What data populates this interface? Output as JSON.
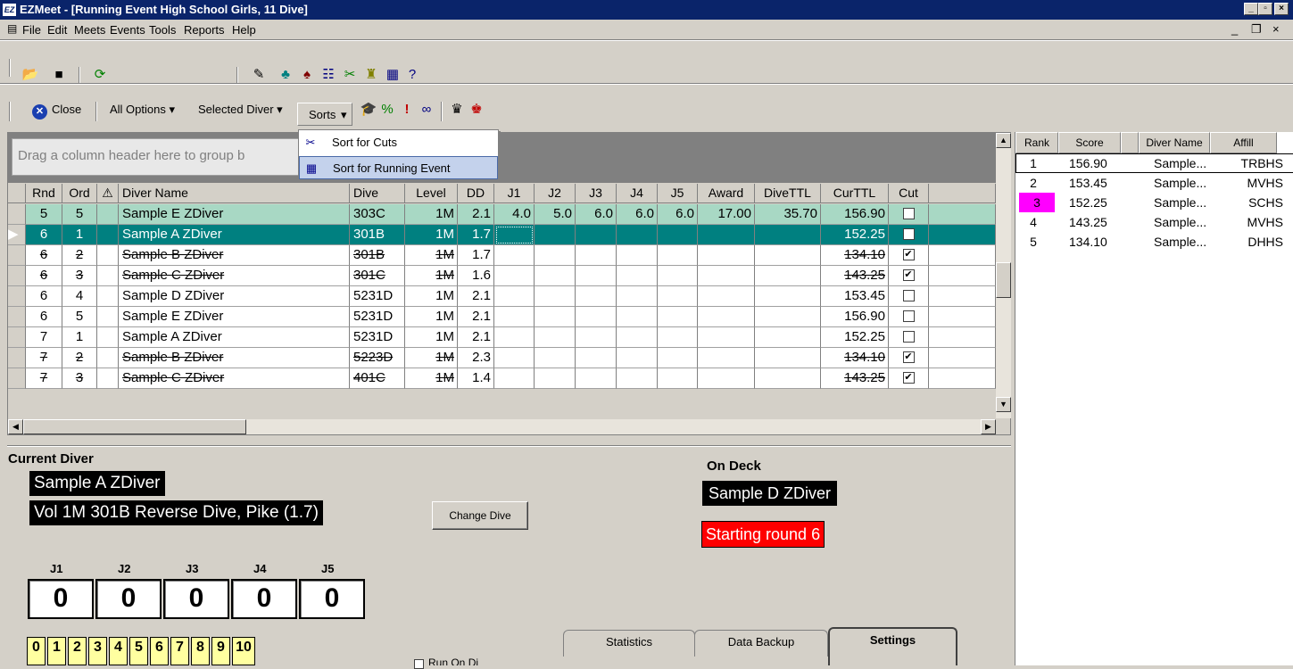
{
  "window": {
    "title": "EZMeet - [Running Event High School Girls, 11 Dive]",
    "app_icon": "EZ"
  },
  "menu": [
    "File",
    "Edit",
    "Meets",
    "Events",
    "Tools",
    "Reports",
    "Help"
  ],
  "toolbar2": {
    "close_label": "Close",
    "all_options": "All Options",
    "selected_diver": "Selected Diver",
    "sorts": "Sorts"
  },
  "sorts_menu": [
    {
      "label": "Sort for Cuts"
    },
    {
      "label": "Sort for Running Event"
    }
  ],
  "grid": {
    "group_hint": "Drag a column header here to group b",
    "columns": [
      "Rnd",
      "Ord",
      "",
      "Diver Name",
      "Dive",
      "Level",
      "DD",
      "J1",
      "J2",
      "J3",
      "J4",
      "J5",
      "Award",
      "DiveTTL",
      "CurTTL",
      "Cut"
    ],
    "rows": [
      {
        "rnd": "5",
        "ord": "5",
        "name": "Sample E ZDiver",
        "dive": "303C",
        "level": "1M",
        "dd": "2.1",
        "j1": "4.0",
        "j2": "5.0",
        "j3": "6.0",
        "j4": "6.0",
        "j5": "6.0",
        "award": "17.00",
        "divettl": "35.70",
        "curttl": "156.90",
        "cut": false
      },
      {
        "rnd": "6",
        "ord": "1",
        "name": "Sample A ZDiver",
        "dive": "301B",
        "level": "1M",
        "dd": "1.7",
        "j1": "",
        "j2": "",
        "j3": "",
        "j4": "",
        "j5": "",
        "award": "",
        "divettl": "",
        "curttl": "152.25",
        "cut": false
      },
      {
        "rnd": "6",
        "ord": "2",
        "name": "Sample B ZDiver",
        "dive": "301B",
        "level": "1M",
        "dd": "1.7",
        "j1": "",
        "j2": "",
        "j3": "",
        "j4": "",
        "j5": "",
        "award": "",
        "divettl": "",
        "curttl": "134.10",
        "cut": true
      },
      {
        "rnd": "6",
        "ord": "3",
        "name": "Sample C ZDiver",
        "dive": "301C",
        "level": "1M",
        "dd": "1.6",
        "j1": "",
        "j2": "",
        "j3": "",
        "j4": "",
        "j5": "",
        "award": "",
        "divettl": "",
        "curttl": "143.25",
        "cut": true
      },
      {
        "rnd": "6",
        "ord": "4",
        "name": "Sample D ZDiver",
        "dive": "5231D",
        "level": "1M",
        "dd": "2.1",
        "j1": "",
        "j2": "",
        "j3": "",
        "j4": "",
        "j5": "",
        "award": "",
        "divettl": "",
        "curttl": "153.45",
        "cut": false
      },
      {
        "rnd": "6",
        "ord": "5",
        "name": "Sample E ZDiver",
        "dive": "5231D",
        "level": "1M",
        "dd": "2.1",
        "j1": "",
        "j2": "",
        "j3": "",
        "j4": "",
        "j5": "",
        "award": "",
        "divettl": "",
        "curttl": "156.90",
        "cut": false
      },
      {
        "rnd": "7",
        "ord": "1",
        "name": "Sample A ZDiver",
        "dive": "5231D",
        "level": "1M",
        "dd": "2.1",
        "j1": "",
        "j2": "",
        "j3": "",
        "j4": "",
        "j5": "",
        "award": "",
        "divettl": "",
        "curttl": "152.25",
        "cut": false
      },
      {
        "rnd": "7",
        "ord": "2",
        "name": "Sample B ZDiver",
        "dive": "5223D",
        "level": "1M",
        "dd": "2.3",
        "j1": "",
        "j2": "",
        "j3": "",
        "j4": "",
        "j5": "",
        "award": "",
        "divettl": "",
        "curttl": "134.10",
        "cut": true
      },
      {
        "rnd": "7",
        "ord": "3",
        "name": "Sample C ZDiver",
        "dive": "401C",
        "level": "1M",
        "dd": "1.4",
        "j1": "",
        "j2": "",
        "j3": "",
        "j4": "",
        "j5": "",
        "award": "",
        "divettl": "",
        "curttl": "143.25",
        "cut": true
      }
    ]
  },
  "standings": {
    "columns": [
      "Rank",
      "Score",
      "Diver Name",
      "Affill"
    ],
    "rows": [
      {
        "rank": "1",
        "score": "156.90",
        "name": "Sample...",
        "affil": "TRBHS"
      },
      {
        "rank": "2",
        "score": "153.45",
        "name": "Sample...",
        "affil": "MVHS"
      },
      {
        "rank": "3",
        "score": "152.25",
        "name": "Sample...",
        "affil": "SCHS"
      },
      {
        "rank": "4",
        "score": "143.25",
        "name": "Sample...",
        "affil": "MVHS"
      },
      {
        "rank": "5",
        "score": "134.10",
        "name": "Sample...",
        "affil": "DHHS"
      }
    ]
  },
  "current": {
    "label": "Current Diver",
    "name": "Sample A ZDiver",
    "dive": "Vol 1M 301B Reverse Dive, Pike (1.7)",
    "change_dive": "Change Dive",
    "judges": [
      "J1",
      "J2",
      "J3",
      "J4",
      "J5"
    ],
    "scores": [
      "0",
      "0",
      "0",
      "0",
      "0"
    ],
    "keypad": [
      "0",
      "1",
      "2",
      "3",
      "4",
      "5",
      "6",
      "7",
      "8",
      "9",
      "10"
    ]
  },
  "ondeck": {
    "label": "On Deck",
    "name": "Sample D ZDiver",
    "status": "Starting round 6"
  },
  "tabs": [
    "Statistics",
    "Data Backup",
    "Settings"
  ],
  "partial_checkbox_label": "Run On Di",
  "colors": {
    "title_bar": "#0a246a",
    "selected_row": "#008080",
    "prev_row": "#a8d8c4",
    "rank3_highlight": "#ff00ff",
    "status_red": "#ff0000"
  }
}
